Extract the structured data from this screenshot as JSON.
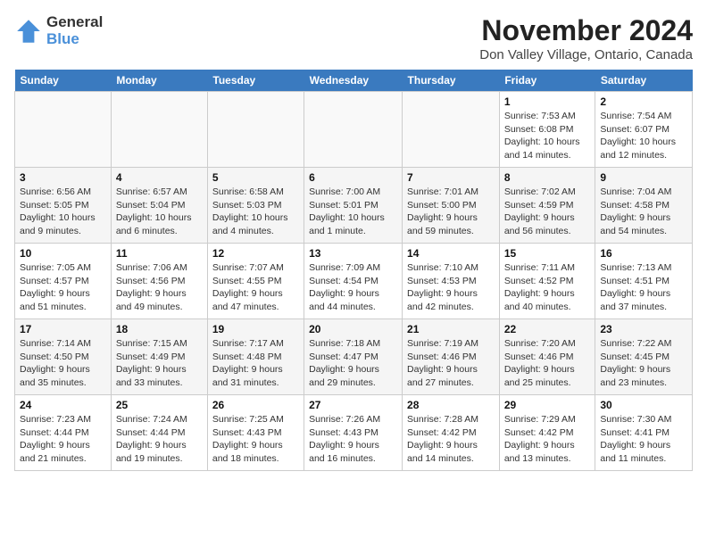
{
  "logo": {
    "general": "General",
    "blue": "Blue"
  },
  "header": {
    "month": "November 2024",
    "location": "Don Valley Village, Ontario, Canada"
  },
  "weekdays": [
    "Sunday",
    "Monday",
    "Tuesday",
    "Wednesday",
    "Thursday",
    "Friday",
    "Saturday"
  ],
  "weeks": [
    [
      {
        "day": "",
        "info": ""
      },
      {
        "day": "",
        "info": ""
      },
      {
        "day": "",
        "info": ""
      },
      {
        "day": "",
        "info": ""
      },
      {
        "day": "",
        "info": ""
      },
      {
        "day": "1",
        "info": "Sunrise: 7:53 AM\nSunset: 6:08 PM\nDaylight: 10 hours and 14 minutes."
      },
      {
        "day": "2",
        "info": "Sunrise: 7:54 AM\nSunset: 6:07 PM\nDaylight: 10 hours and 12 minutes."
      }
    ],
    [
      {
        "day": "3",
        "info": "Sunrise: 6:56 AM\nSunset: 5:05 PM\nDaylight: 10 hours and 9 minutes."
      },
      {
        "day": "4",
        "info": "Sunrise: 6:57 AM\nSunset: 5:04 PM\nDaylight: 10 hours and 6 minutes."
      },
      {
        "day": "5",
        "info": "Sunrise: 6:58 AM\nSunset: 5:03 PM\nDaylight: 10 hours and 4 minutes."
      },
      {
        "day": "6",
        "info": "Sunrise: 7:00 AM\nSunset: 5:01 PM\nDaylight: 10 hours and 1 minute."
      },
      {
        "day": "7",
        "info": "Sunrise: 7:01 AM\nSunset: 5:00 PM\nDaylight: 9 hours and 59 minutes."
      },
      {
        "day": "8",
        "info": "Sunrise: 7:02 AM\nSunset: 4:59 PM\nDaylight: 9 hours and 56 minutes."
      },
      {
        "day": "9",
        "info": "Sunrise: 7:04 AM\nSunset: 4:58 PM\nDaylight: 9 hours and 54 minutes."
      }
    ],
    [
      {
        "day": "10",
        "info": "Sunrise: 7:05 AM\nSunset: 4:57 PM\nDaylight: 9 hours and 51 minutes."
      },
      {
        "day": "11",
        "info": "Sunrise: 7:06 AM\nSunset: 4:56 PM\nDaylight: 9 hours and 49 minutes."
      },
      {
        "day": "12",
        "info": "Sunrise: 7:07 AM\nSunset: 4:55 PM\nDaylight: 9 hours and 47 minutes."
      },
      {
        "day": "13",
        "info": "Sunrise: 7:09 AM\nSunset: 4:54 PM\nDaylight: 9 hours and 44 minutes."
      },
      {
        "day": "14",
        "info": "Sunrise: 7:10 AM\nSunset: 4:53 PM\nDaylight: 9 hours and 42 minutes."
      },
      {
        "day": "15",
        "info": "Sunrise: 7:11 AM\nSunset: 4:52 PM\nDaylight: 9 hours and 40 minutes."
      },
      {
        "day": "16",
        "info": "Sunrise: 7:13 AM\nSunset: 4:51 PM\nDaylight: 9 hours and 37 minutes."
      }
    ],
    [
      {
        "day": "17",
        "info": "Sunrise: 7:14 AM\nSunset: 4:50 PM\nDaylight: 9 hours and 35 minutes."
      },
      {
        "day": "18",
        "info": "Sunrise: 7:15 AM\nSunset: 4:49 PM\nDaylight: 9 hours and 33 minutes."
      },
      {
        "day": "19",
        "info": "Sunrise: 7:17 AM\nSunset: 4:48 PM\nDaylight: 9 hours and 31 minutes."
      },
      {
        "day": "20",
        "info": "Sunrise: 7:18 AM\nSunset: 4:47 PM\nDaylight: 9 hours and 29 minutes."
      },
      {
        "day": "21",
        "info": "Sunrise: 7:19 AM\nSunset: 4:46 PM\nDaylight: 9 hours and 27 minutes."
      },
      {
        "day": "22",
        "info": "Sunrise: 7:20 AM\nSunset: 4:46 PM\nDaylight: 9 hours and 25 minutes."
      },
      {
        "day": "23",
        "info": "Sunrise: 7:22 AM\nSunset: 4:45 PM\nDaylight: 9 hours and 23 minutes."
      }
    ],
    [
      {
        "day": "24",
        "info": "Sunrise: 7:23 AM\nSunset: 4:44 PM\nDaylight: 9 hours and 21 minutes."
      },
      {
        "day": "25",
        "info": "Sunrise: 7:24 AM\nSunset: 4:44 PM\nDaylight: 9 hours and 19 minutes."
      },
      {
        "day": "26",
        "info": "Sunrise: 7:25 AM\nSunset: 4:43 PM\nDaylight: 9 hours and 18 minutes."
      },
      {
        "day": "27",
        "info": "Sunrise: 7:26 AM\nSunset: 4:43 PM\nDaylight: 9 hours and 16 minutes."
      },
      {
        "day": "28",
        "info": "Sunrise: 7:28 AM\nSunset: 4:42 PM\nDaylight: 9 hours and 14 minutes."
      },
      {
        "day": "29",
        "info": "Sunrise: 7:29 AM\nSunset: 4:42 PM\nDaylight: 9 hours and 13 minutes."
      },
      {
        "day": "30",
        "info": "Sunrise: 7:30 AM\nSunset: 4:41 PM\nDaylight: 9 hours and 11 minutes."
      }
    ]
  ]
}
